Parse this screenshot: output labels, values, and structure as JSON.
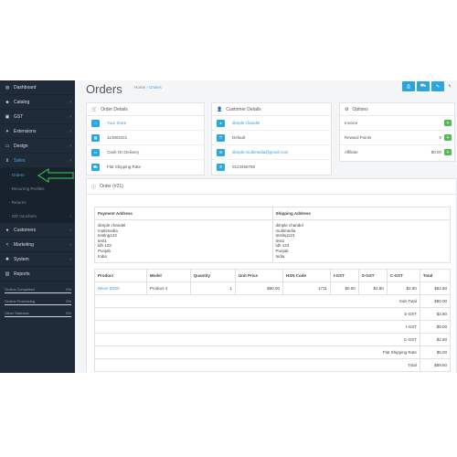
{
  "sidebar": {
    "items": [
      {
        "label": "Dashboard",
        "icon": "dashboard-icon",
        "glyph": "◍",
        "chev": ""
      },
      {
        "label": "Catalog",
        "icon": "tag-icon",
        "glyph": "⬥",
        "chev": "›"
      },
      {
        "label": "GST",
        "icon": "box-icon",
        "glyph": "▣",
        "chev": "›"
      },
      {
        "label": "Extensions",
        "icon": "puzzle-icon",
        "glyph": "✦",
        "chev": "›"
      },
      {
        "label": "Design",
        "icon": "monitor-icon",
        "glyph": "▭",
        "chev": "›"
      },
      {
        "label": "Sales",
        "icon": "cart-icon",
        "glyph": "⊻",
        "chev": "›"
      }
    ],
    "sales_sub": [
      {
        "label": "Orders",
        "chev": ""
      },
      {
        "label": "Recurring Profiles",
        "chev": ""
      },
      {
        "label": "Returns",
        "chev": ""
      },
      {
        "label": "Gift Vouchers",
        "chev": "›"
      }
    ],
    "items2": [
      {
        "label": "Customers",
        "icon": "user-icon",
        "glyph": "●",
        "chev": "›"
      },
      {
        "label": "Marketing",
        "icon": "share-icon",
        "glyph": "<",
        "chev": "›"
      },
      {
        "label": "System",
        "icon": "cog-icon",
        "glyph": "✹",
        "chev": "›"
      },
      {
        "label": "Reports",
        "icon": "bar-chart-icon",
        "glyph": "▥",
        "chev": ""
      }
    ],
    "statuses": [
      {
        "label": "Orders Completed",
        "value": "0%"
      },
      {
        "label": "Orders Processing",
        "value": "0%"
      },
      {
        "label": "Other Statuses",
        "value": "0%"
      }
    ]
  },
  "header": {
    "title": "Orders",
    "breadcrumb_home": "Home",
    "breadcrumb_sep": "›",
    "breadcrumb_current": "Orders",
    "btn_print": "⎙",
    "btn_ship": "⛟",
    "btn_edit": "✎",
    "btn_back": "↰"
  },
  "order_details": {
    "title": "Order Details",
    "store": "Your Store",
    "date": "11/08/2021",
    "payment": "Cash On Delivery",
    "shipping": "Flat Shipping Rate"
  },
  "customer_details": {
    "title": "Customer Details",
    "name": "dimple chandel",
    "group": "Default",
    "email": "dimple.multimedia@gmail.com",
    "phone": "0123456789"
  },
  "options": {
    "title": "Options",
    "rows": [
      {
        "label": "Invoice",
        "value": "",
        "btn": "+"
      },
      {
        "label": "Reward Points",
        "value": "0",
        "btn": "+"
      },
      {
        "label": "Affiliate",
        "value": "$0.00",
        "btn": "+"
      }
    ]
  },
  "order": {
    "title": "Order (#21)",
    "payment_address_label": "Payment Address",
    "shipping_address_label": "Shipping Address",
    "payment_address": [
      "dimple chandel",
      "multimedia",
      "testing123",
      "test1",
      "ldh 123",
      "Punjab",
      "India"
    ],
    "shipping_address": [
      "dimple chandel",
      "multimedia",
      "testing123",
      "test1",
      "ldh 123",
      "Punjab",
      "India"
    ],
    "columns": [
      "Product",
      "Model",
      "Quantity",
      "Unit Price",
      "HSN Code",
      "I-GST",
      "S-GST",
      "C-GST",
      "Total"
    ],
    "products": [
      {
        "product": "Nikon D300",
        "model": "Product 4",
        "quantity": "1",
        "unit_price": "$80.00",
        "hsn": "1711",
        "igst": "$0.00",
        "sgst": "$2.80",
        "cgst": "$2.80",
        "total": "$84.80"
      }
    ],
    "totals": [
      {
        "label": "Sub-Total",
        "value": "$80.00"
      },
      {
        "label": "S-GST",
        "value": "$2.80"
      },
      {
        "label": "I-GST",
        "value": "$0.00"
      },
      {
        "label": "C-GST",
        "value": "$2.80"
      },
      {
        "label": "Flat Shipping Rate",
        "value": "$5.00"
      },
      {
        "label": "Total",
        "value": "$89.60"
      }
    ]
  },
  "colors": {
    "accent": "#2fa3de",
    "sidebar": "#1f2b38",
    "arrow": "#2fb14b",
    "success": "#58b957"
  }
}
